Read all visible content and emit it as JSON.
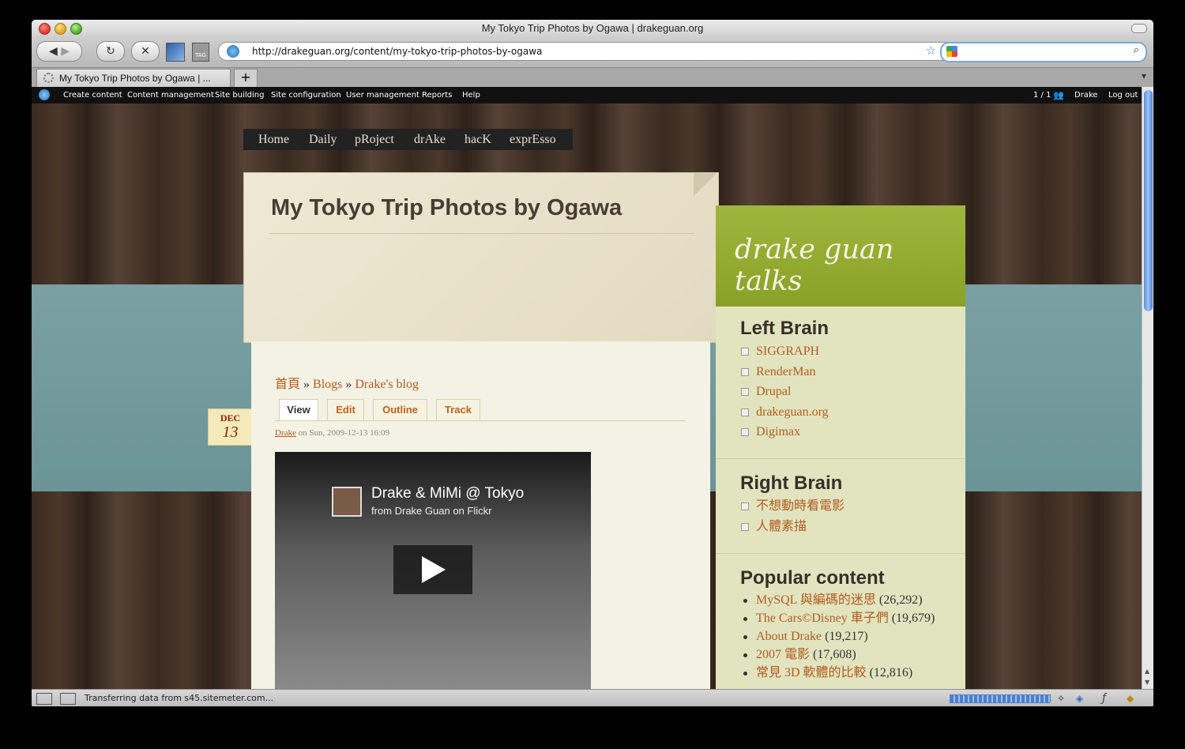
{
  "window": {
    "title": "My Tokyo Trip Photos by Ogawa | drakeguan.org"
  },
  "toolbar": {
    "url": "http://drakeguan.org/content/my-tokyo-trip-photos-by-ogawa",
    "tag_label": "TAG",
    "search_value": ""
  },
  "tabs": [
    {
      "label": "My Tokyo Trip Photos by Ogawa | ..."
    }
  ],
  "admin_menu": {
    "items": [
      "Create content",
      "Content management",
      "Site building",
      "Site configuration",
      "User management",
      "Reports",
      "Help"
    ],
    "right": {
      "users": "1 / 1",
      "user": "Drake",
      "logout": "Log out"
    }
  },
  "site_nav": [
    "Home",
    "Daily",
    "pRoject",
    "drAke",
    "hacK",
    "exprEsso"
  ],
  "page": {
    "title": "My Tokyo Trip Photos by Ogawa",
    "breadcrumb": [
      "首頁",
      "Blogs",
      "Drake's blog"
    ],
    "breadcrumb_sep": "»",
    "local_tabs": [
      "View",
      "Edit",
      "Outline",
      "Track"
    ],
    "author": "Drake",
    "byline_rest": " on Sun, 2009-12-13 16:09",
    "date": {
      "month": "DEC",
      "day": "13"
    },
    "video": {
      "title": "Drake & MiMi @ Tokyo",
      "subtitle": "from Drake Guan on Flickr"
    }
  },
  "sidebar": {
    "banner": "drake guan talks",
    "left_brain": {
      "title": "Left Brain",
      "items": [
        "SIGGRAPH",
        "RenderMan",
        "Drupal",
        "drakeguan.org",
        "Digimax"
      ]
    },
    "right_brain": {
      "title": "Right Brain",
      "items": [
        "不想動時看電影",
        "人體素描"
      ]
    },
    "popular": {
      "title": "Popular content",
      "items": [
        {
          "label": "MySQL 與編碼的迷思",
          "count": "(26,292)"
        },
        {
          "label": "The Cars©Disney 車子們",
          "count": "(19,679)"
        },
        {
          "label": "About Drake",
          "count": "(19,217)"
        },
        {
          "label": "2007 電影",
          "count": "(17,608)"
        },
        {
          "label": "常見 3D 軟體的比較",
          "count": "(12,816)"
        }
      ]
    }
  },
  "status": {
    "text": "Transferring data from s45.sitemeter.com..."
  },
  "colors": {
    "link": "#b15d1f",
    "banner": "#98ae33",
    "admin_bar": "#111111"
  }
}
